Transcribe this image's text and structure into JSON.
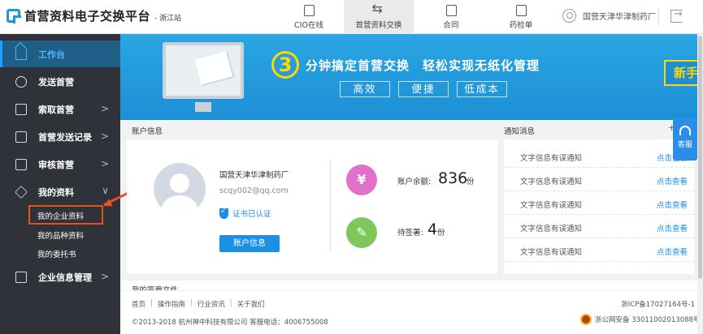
{
  "header": {
    "app_title": "首营资料电子交换平台",
    "site_label": "- 浙江站",
    "nav": [
      {
        "label": "CIO在线"
      },
      {
        "label": "首营资料交换"
      },
      {
        "label": "合同"
      },
      {
        "label": "药检单"
      }
    ],
    "user_name": "国营天津华津制药厂"
  },
  "sidebar": {
    "items": [
      {
        "label": "工作台"
      },
      {
        "label": "发送首营"
      },
      {
        "label": "索取首营"
      },
      {
        "label": "首营发送记录"
      },
      {
        "label": "审核首营"
      },
      {
        "label": "我的资料"
      },
      {
        "label": "企业信息管理"
      }
    ],
    "sub_items": [
      {
        "label": "我的企业资料"
      },
      {
        "label": "我的品种资料"
      },
      {
        "label": "我的委托书"
      }
    ],
    "chevron": ">",
    "chevron_down": "∨"
  },
  "banner": {
    "number": "3",
    "headline": "分钟搞定首营交换　轻松实现无纸化管理",
    "pills": [
      "高效",
      "便捷",
      "低成本"
    ],
    "newhand": "新手"
  },
  "account": {
    "section_title": "账户信息",
    "company": "国营天津华津制药厂",
    "email": "scqy002@qq.com",
    "cert_label": "证书已认证",
    "button_label": "账户信息",
    "balance_label": "账户余额:",
    "balance_value": "836",
    "balance_unit": "份",
    "pending_label": "待签署:",
    "pending_value": "4",
    "pending_unit": "份",
    "money_icon_glyph": "¥",
    "sign_icon_glyph": "✎"
  },
  "notices": {
    "section_title": "通知消息",
    "more": "+",
    "items": [
      {
        "text": "文字信息有误通知",
        "link": "点击查看"
      },
      {
        "text": "文字信息有误通知",
        "link": "点击查看"
      },
      {
        "text": "文字信息有误通知",
        "link": "点击查看"
      },
      {
        "text": "文字信息有误通知",
        "link": "点击查看"
      },
      {
        "text": "文字信息有误通知",
        "link": "点击查看"
      }
    ]
  },
  "service": {
    "label": "客服"
  },
  "docs": {
    "title": "我的签章文件"
  },
  "footer": {
    "links": [
      "首页",
      "操作指南",
      "行业资讯",
      "关于我们"
    ],
    "link_separator": "|",
    "icp": "浙ICP备17027164号-1",
    "copyright": "©2013-2018  杭州神中科技有限公司  客服电话：4006755008",
    "police": "浙公网安备 33011002013088号"
  },
  "colors": {
    "accent": "#1b8fe0",
    "sidebar_bg": "#2f3238",
    "banner_bg": "#1d8fd6",
    "highlight": "#e3531d",
    "money": "#df72c8",
    "sign": "#7dc75b"
  }
}
